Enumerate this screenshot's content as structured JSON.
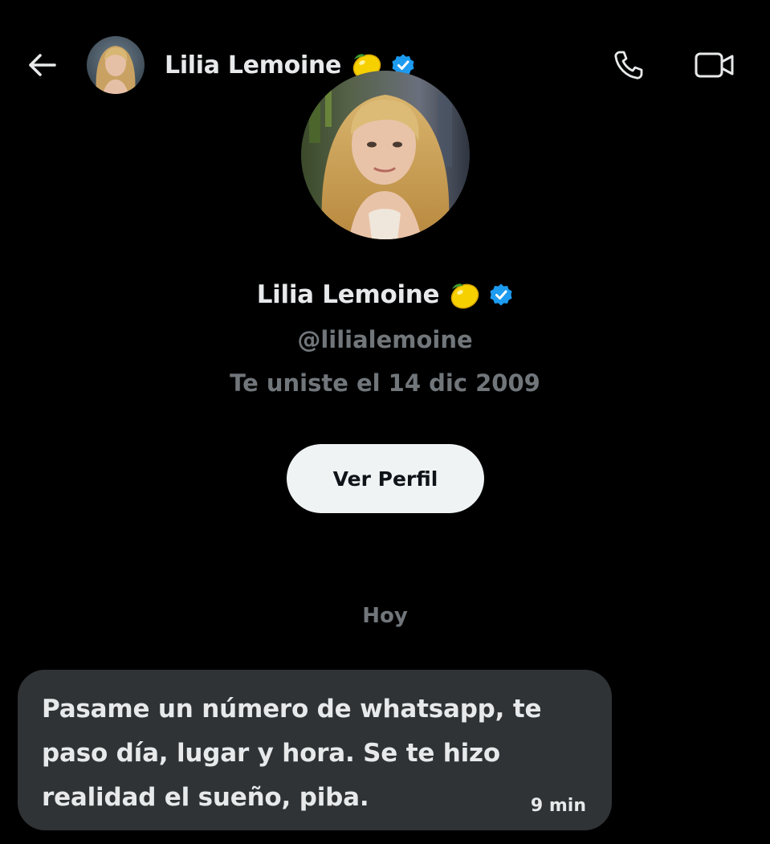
{
  "header": {
    "back_icon": "arrow-left-icon",
    "title": "Lilia Lemoine",
    "call_icon": "phone-icon",
    "video_icon": "video-camera-icon"
  },
  "profile": {
    "name": "Lilia Lemoine",
    "handle": "@lilialemoine",
    "joined": "Te uniste el 14 dic 2009",
    "view_profile_label": "Ver Perfil"
  },
  "conversation": {
    "date_divider": "Hoy",
    "messages": [
      {
        "text": "Pasame un número de whatsapp, te paso día, lugar y hora. Se te hizo realidad el sueño, piba.",
        "time": "9 min"
      }
    ]
  },
  "colors": {
    "background": "#000000",
    "text_primary": "#e7e9ea",
    "text_secondary": "#71767b",
    "bubble": "#2f3336",
    "verified": "#1d9bf0",
    "button_bg": "#eff3f4"
  }
}
